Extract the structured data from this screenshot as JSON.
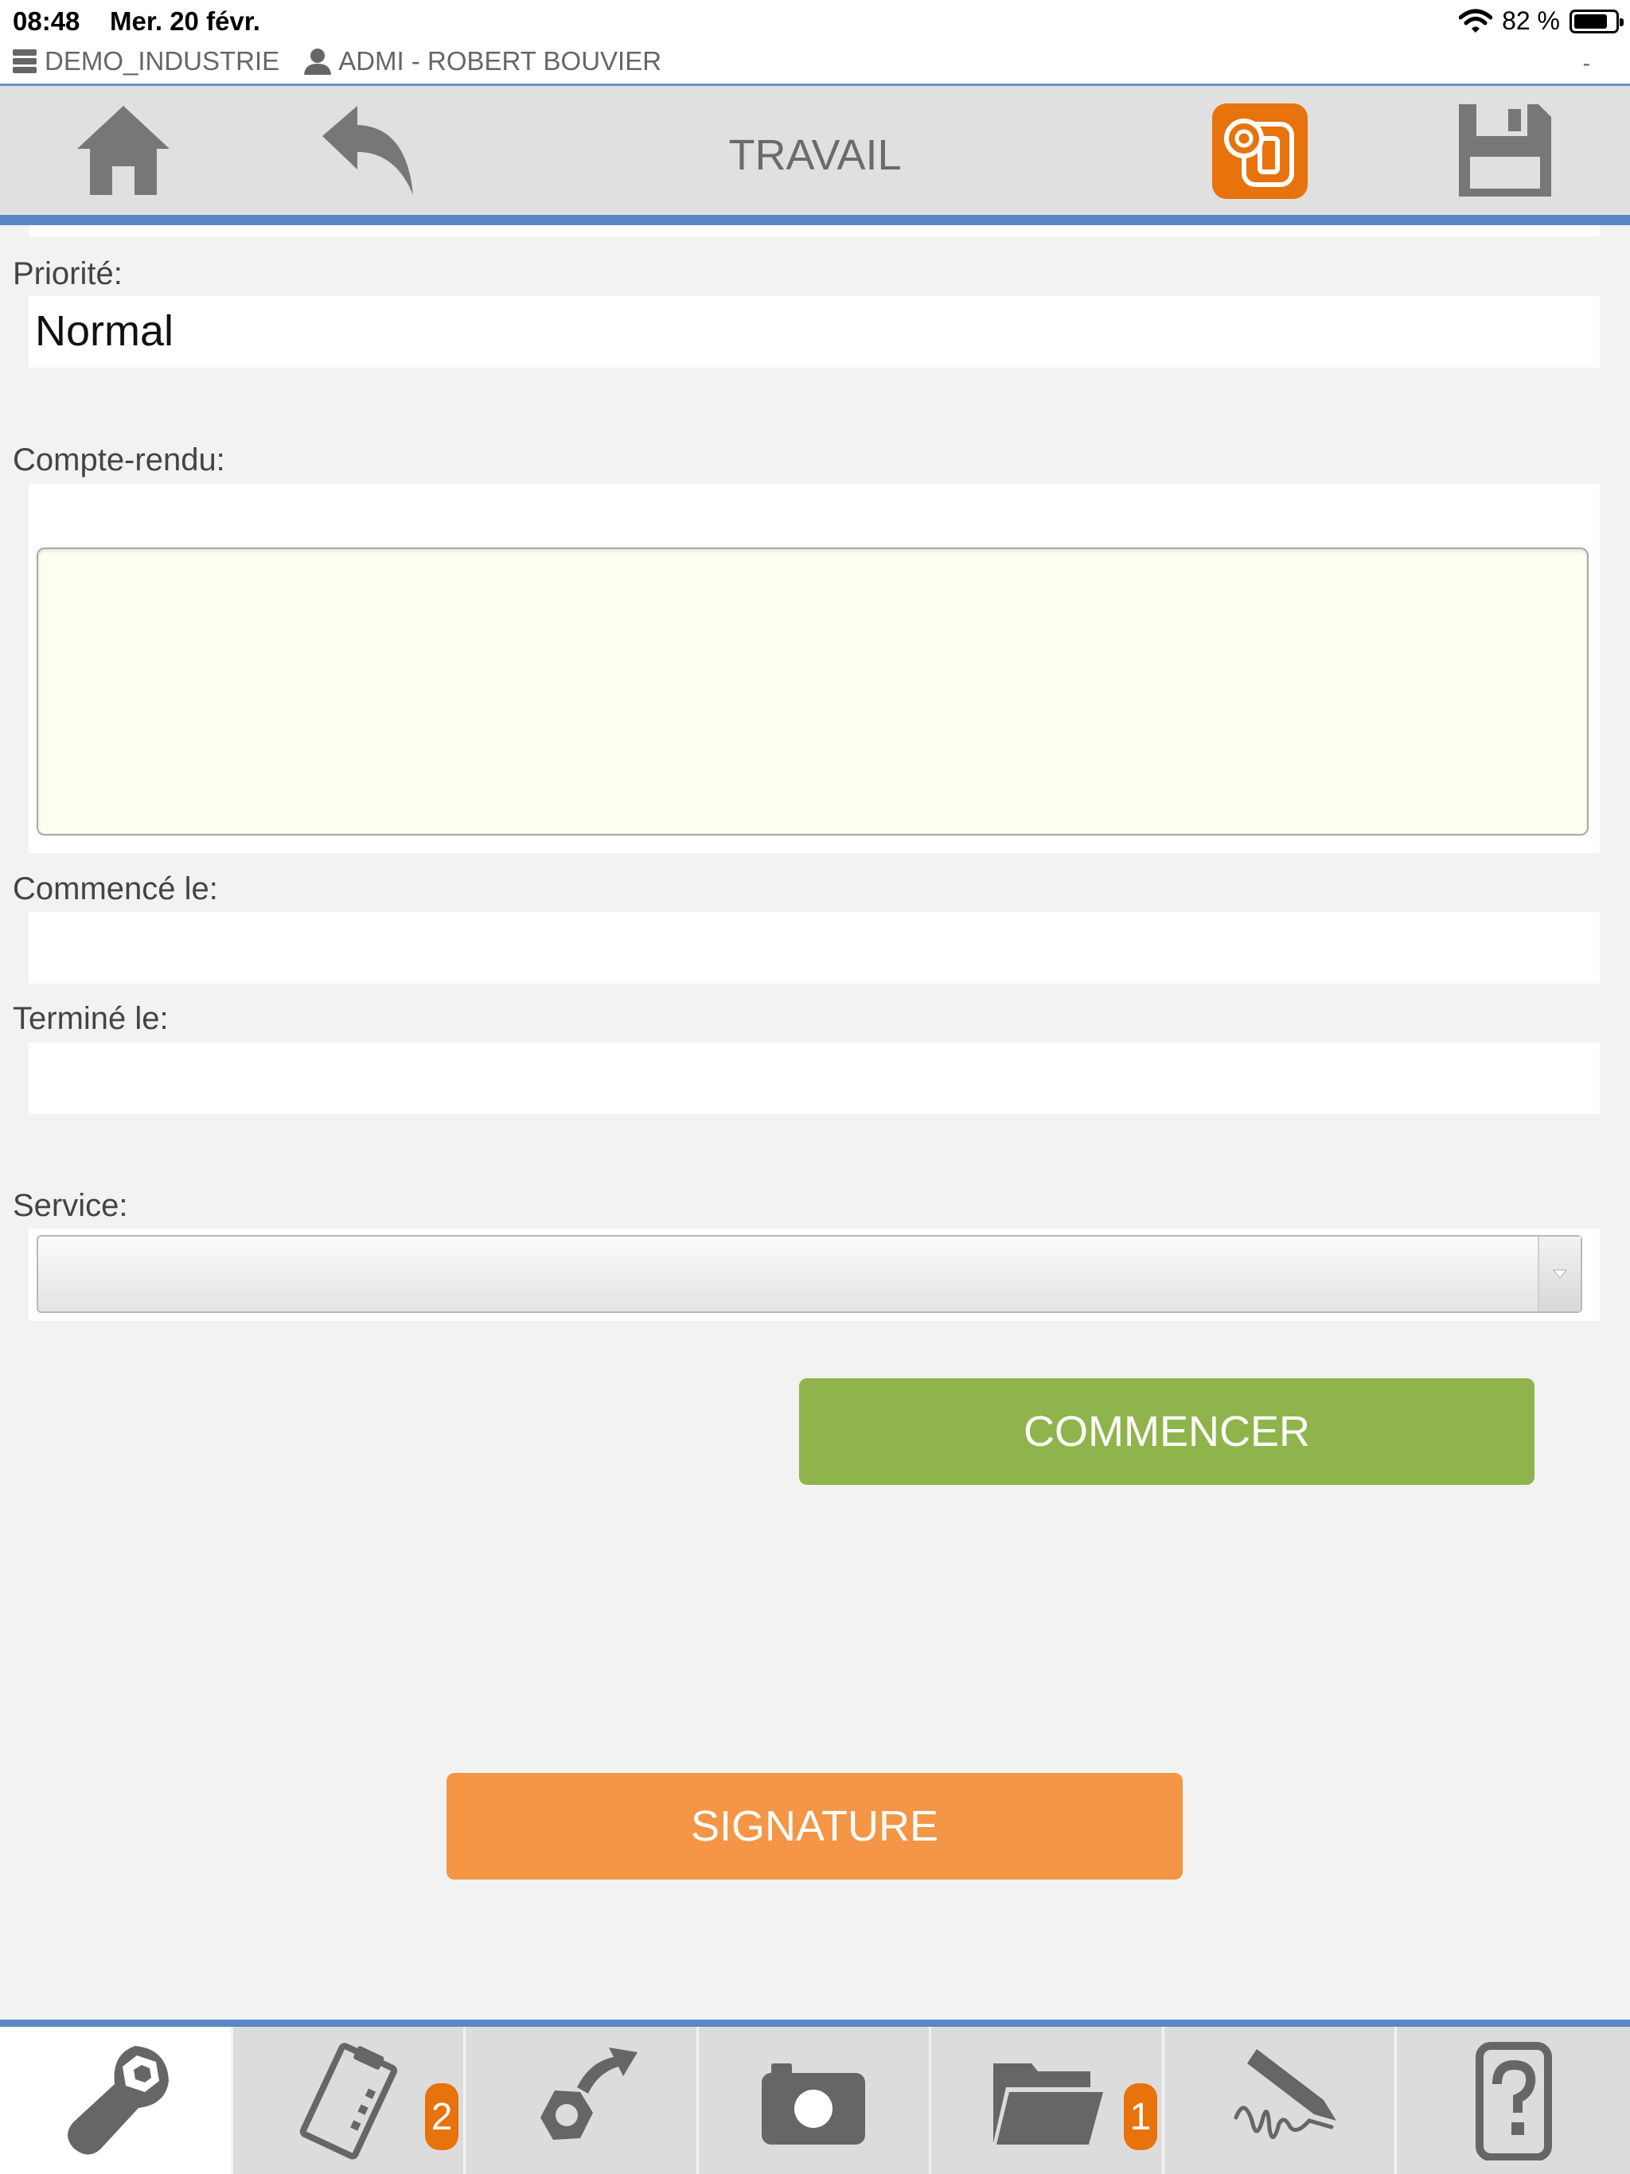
{
  "status_bar": {
    "time": "08:48",
    "date": "Mer. 20 févr.",
    "battery": "82 %"
  },
  "context": {
    "company": "DEMO_INDUSTRIE",
    "user": "ADMI - ROBERT BOUVIER",
    "extra": "-"
  },
  "toolbar": {
    "title": "TRAVAIL",
    "accent_color": "#e8720c"
  },
  "form": {
    "priority_label": "Priorité:",
    "priority_value": "Normal",
    "report_label": "Compte-rendu:",
    "report_value": "",
    "started_label": "Commencé le:",
    "started_value": "",
    "ended_label": "Terminé le:",
    "ended_value": "",
    "service_label": "Service:",
    "service_value": ""
  },
  "actions": {
    "start_label": "COMMENCER",
    "start_color": "#8fb44c",
    "signature_label": "SIGNATURE",
    "signature_color": "#f49646"
  },
  "tabs": [
    {
      "icon": "wrench-nut-icon",
      "badge": ""
    },
    {
      "icon": "checklist-icon",
      "badge": "2"
    },
    {
      "icon": "parts-transfer-icon",
      "badge": ""
    },
    {
      "icon": "camera-icon",
      "badge": ""
    },
    {
      "icon": "folder-icon",
      "badge": "1"
    },
    {
      "icon": "signature-icon",
      "badge": ""
    },
    {
      "icon": "help-device-icon",
      "badge": ""
    }
  ]
}
